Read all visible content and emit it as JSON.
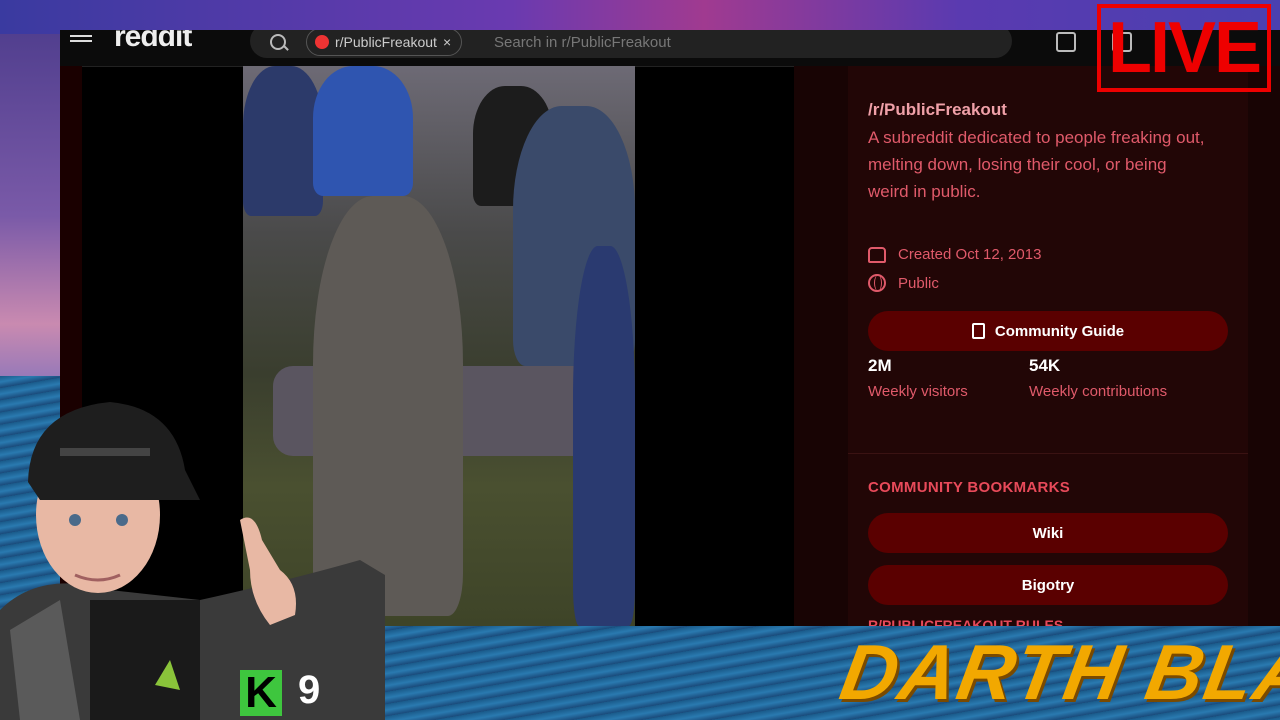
{
  "browser": {
    "logo_text": "reddit",
    "search": {
      "chip_label": "r/PublicFreakout",
      "chip_close": "×",
      "placeholder": "Search in r/PublicFreakout"
    }
  },
  "sidebar": {
    "sub_name": "/r/PublicFreakout",
    "description": "A subreddit dedicated to people freaking out, melting down, losing their cool, or being weird in public.",
    "created": "Created Oct 12, 2013",
    "visibility": "Public",
    "community_guide_label": "Community Guide",
    "stats": [
      {
        "value": "2M",
        "label": "Weekly visitors"
      },
      {
        "value": "54K",
        "label": "Weekly contributions"
      }
    ],
    "bookmarks_title": "COMMUNITY BOOKMARKS",
    "bookmarks": [
      "Wiki",
      "Bigotry"
    ],
    "cut_off_title": "R/PUBLICFREAKOUT RULES"
  },
  "overlay": {
    "live_label": "LIVE",
    "brand_text": "DARTH BLAZE",
    "kick_logo": "K",
    "viewer_count": "9"
  },
  "colors": {
    "accent_red": "#e05a6a",
    "button_bg": "#5a0000",
    "live_red": "#ee0000",
    "brand_gold": "#f2a800"
  }
}
